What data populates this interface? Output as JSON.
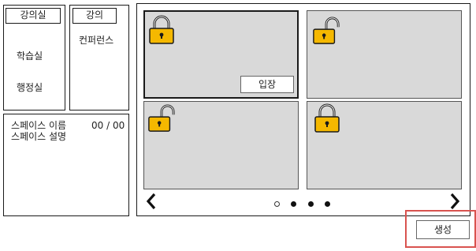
{
  "sidebar": {
    "tabs": [
      {
        "label": "강의실",
        "active": true
      },
      {
        "label": "학습실"
      },
      {
        "label": "행정실"
      }
    ],
    "subtabs": [
      {
        "label": "강의",
        "active": true
      },
      {
        "label": "컨퍼런스"
      }
    ]
  },
  "space_info": {
    "name_label": "스페이스 이름",
    "count": "00 / 00",
    "desc_label": "스페이스 설명"
  },
  "rooms": [
    {
      "locked": true,
      "selected": true,
      "enter_label": "입장"
    },
    {
      "locked": false
    },
    {
      "locked": false
    },
    {
      "locked": true
    }
  ],
  "pager": {
    "prev_icon": "chevron-left-icon",
    "next_icon": "chevron-right-icon",
    "dots": [
      "empty",
      "filled",
      "filled",
      "filled"
    ]
  },
  "actions": {
    "create_label": "생성",
    "highlight_color": "#d9534f"
  }
}
